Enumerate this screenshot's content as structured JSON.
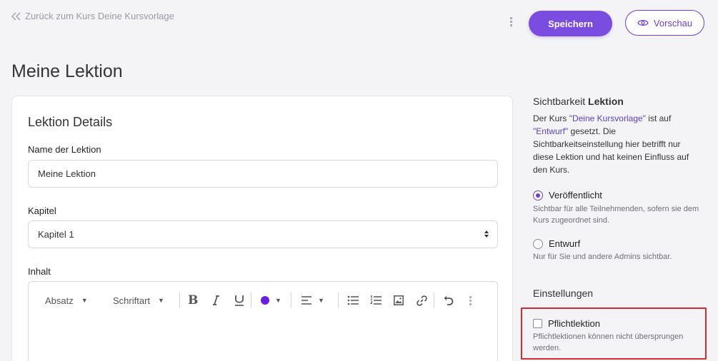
{
  "header": {
    "back_label": "Zurück zum Kurs Deine Kursvorlage",
    "save_label": "Speichern",
    "preview_label": "Vorschau"
  },
  "page": {
    "title": "Meine Lektion"
  },
  "details": {
    "title": "Lektion Details",
    "name_label": "Name der Lektion",
    "name_value": "Meine Lektion",
    "chapter_label": "Kapitel",
    "chapter_value": "Kapitel 1",
    "content_label": "Inhalt"
  },
  "editor": {
    "paragraph_label": "Absatz",
    "font_label": "Schriftart",
    "text_color": "#6a1fe0",
    "icons": [
      "bold-icon",
      "italic-icon",
      "underline-icon",
      "text-color-icon",
      "align-icon",
      "bullet-list-icon",
      "numbered-list-icon",
      "image-icon",
      "link-icon",
      "undo-icon",
      "more-icon"
    ]
  },
  "visibility": {
    "title_prefix": "Sichtbarkeit",
    "title_bold": "Lektion",
    "desc_1": "Der Kurs",
    "course_name": "\"Deine Kursvorlage\"",
    "desc_2": "ist auf",
    "status": "\"Entwurf\"",
    "desc_3": "gesetzt. Die Sichtbarkeitseinstellung hier betrifft nur diese Lektion und hat keinen Einfluss auf den Kurs.",
    "options": [
      {
        "label": "Veröffentlicht",
        "hint": "Sichtbar für alle Teilnehmenden, sofern sie dem Kurs zugeordnet sind.",
        "checked": true
      },
      {
        "label": "Entwurf",
        "hint": "Nur für Sie und andere Admins sichtbar.",
        "checked": false
      }
    ]
  },
  "settings": {
    "title": "Einstellungen",
    "mandatory_label": "Pflichtlektion",
    "mandatory_hint": "Pflichtlektionen können nicht übersprungen werden.",
    "mandatory_checked": false
  },
  "colors": {
    "accent": "#7b4ce0",
    "link": "#5b3fc4",
    "highlight": "#d42d2d"
  }
}
